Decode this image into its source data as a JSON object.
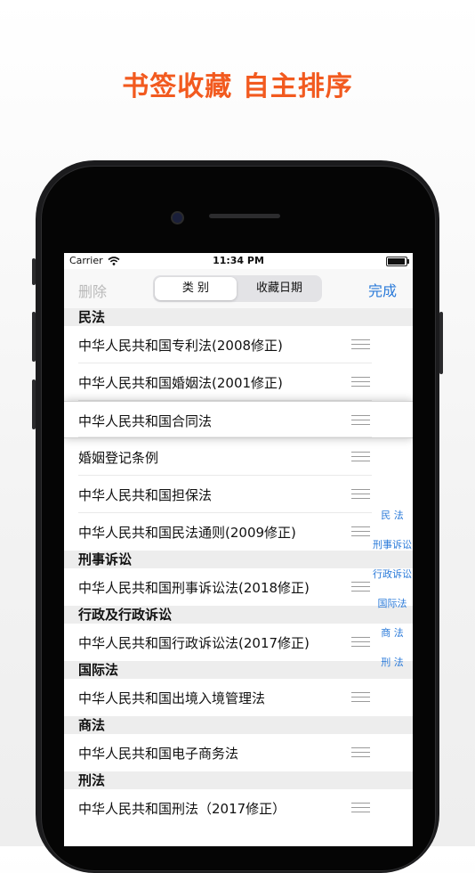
{
  "headline": "书签收藏 自主排序",
  "status_bar": {
    "carrier": "Carrier",
    "time": "11:34 PM",
    "battery_level": 0.95
  },
  "navbar": {
    "delete_label": "删除",
    "done_label": "完成",
    "segments": [
      {
        "label": "类 别",
        "selected": true
      },
      {
        "label": "收藏日期",
        "selected": false
      }
    ]
  },
  "sections": [
    {
      "title": "民法",
      "items": [
        "中华人民共和国专利法(2008修正)",
        "中华人民共和国婚姻法(2001修正)",
        "中华人民共和国合同法",
        "婚姻登记条例",
        "中华人民共和国担保法",
        "中华人民共和国民法通则(2009修正)"
      ]
    },
    {
      "title": "刑事诉讼",
      "items": [
        "中华人民共和国刑事诉讼法(2018修正)"
      ]
    },
    {
      "title": "行政及行政诉讼",
      "items": [
        "中华人民共和国行政诉讼法(2017修正)"
      ]
    },
    {
      "title": "国际法",
      "items": [
        "中华人民共和国出境入境管理法"
      ]
    },
    {
      "title": "商法",
      "items": [
        "中华人民共和国电子商务法"
      ]
    },
    {
      "title": "刑法",
      "items": [
        "中华人民共和国刑法（2017修正）"
      ]
    }
  ],
  "section_index": [
    "民 法",
    "刑事诉讼",
    "行政诉讼",
    "国际法",
    "商 法",
    "刑 法"
  ],
  "colors": {
    "accent": "#2a7ad9",
    "headline": "#f25a1f",
    "disabled": "#b9b9b9"
  }
}
